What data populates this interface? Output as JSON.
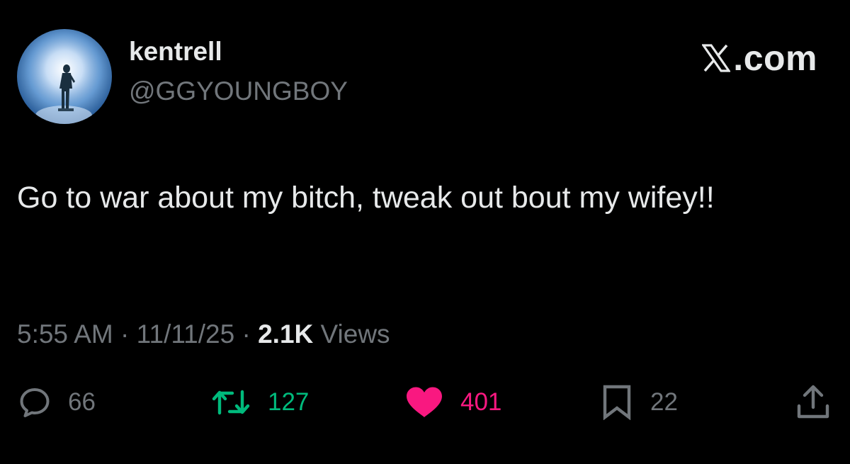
{
  "author": {
    "display_name": "kentrell",
    "handle": "@GGYOUNGBOY",
    "avatar": "avatar"
  },
  "brand": {
    "icon": "x-logo-icon",
    "text": ".com"
  },
  "tweet": {
    "text": "Go to war about my bitch, tweak out bout my wifey!!"
  },
  "meta": {
    "time": "5:55 AM",
    "separator": "·",
    "date": "11/11/25",
    "views_count": "2.1K",
    "views_label": "Views"
  },
  "actions": {
    "reply": {
      "icon": "reply-icon",
      "count": "66"
    },
    "repost": {
      "icon": "repost-icon",
      "count": "127",
      "color": "#00ba7c"
    },
    "like": {
      "icon": "heart-icon",
      "count": "401",
      "color": "#f91880"
    },
    "bookmark": {
      "icon": "bookmark-icon",
      "count": "22"
    },
    "share": {
      "icon": "share-icon"
    }
  },
  "colors": {
    "background": "#000000",
    "primary_text": "#e7e9ea",
    "secondary_text": "#71767b"
  }
}
